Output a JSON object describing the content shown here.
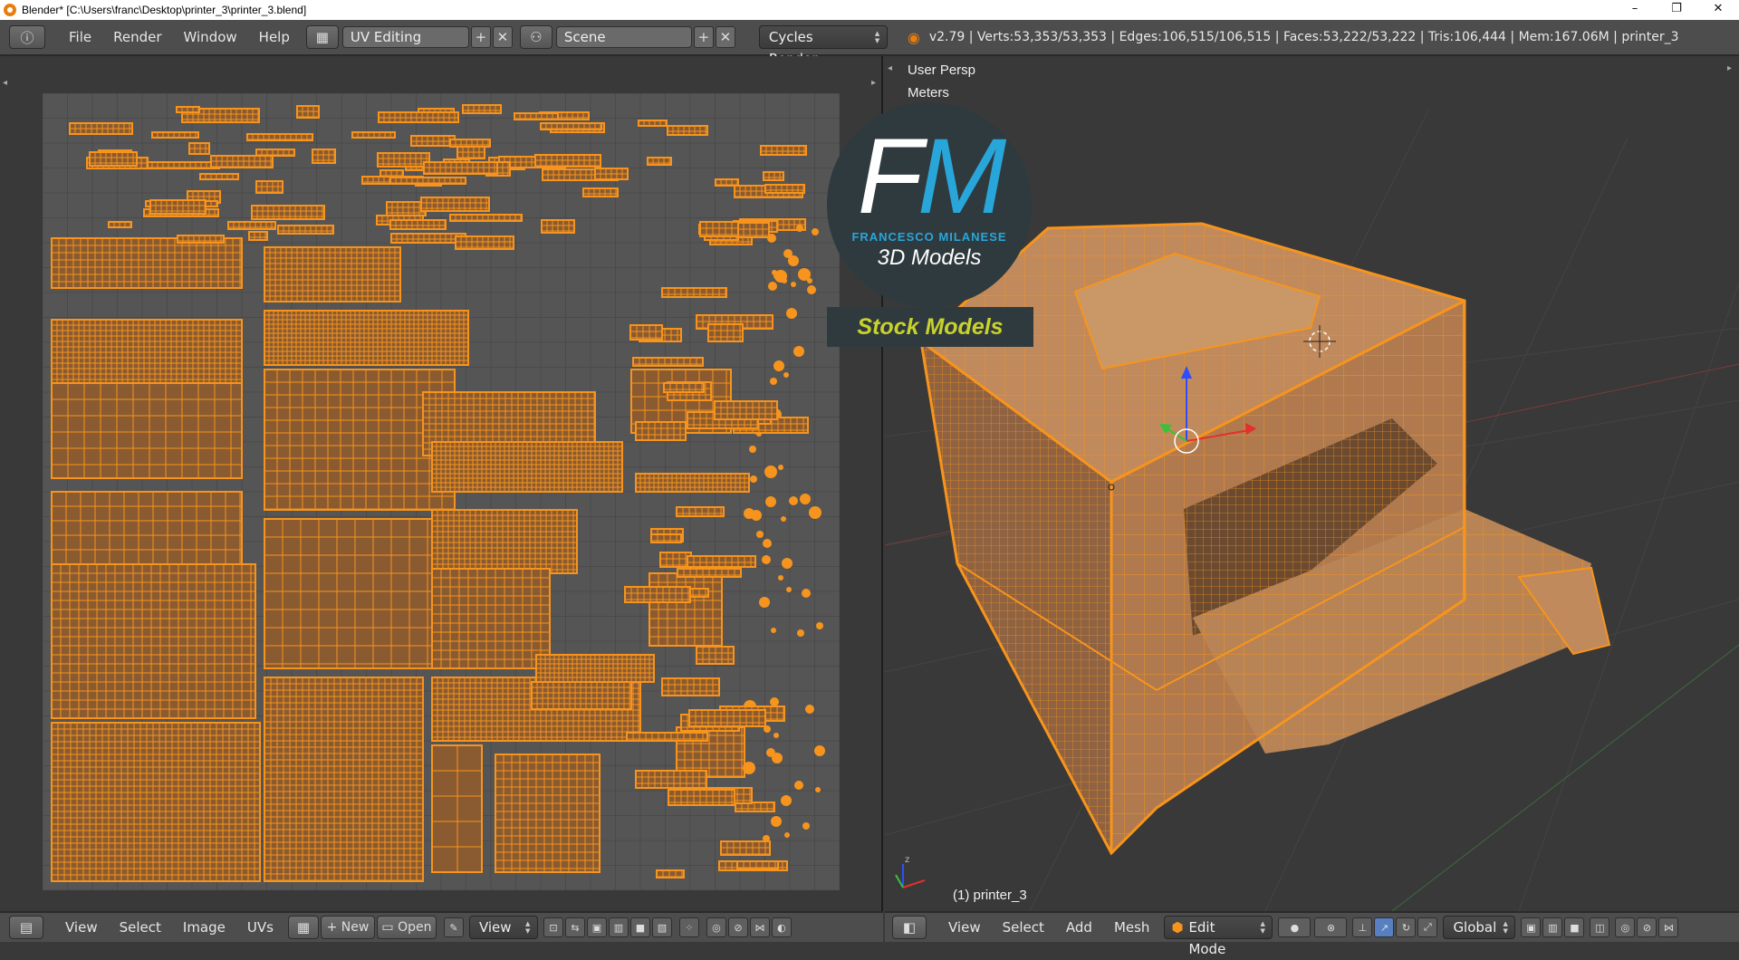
{
  "window": {
    "title": "Blender* [C:\\Users\\franc\\Desktop\\printer_3\\printer_3.blend]",
    "controls": [
      "–",
      "❐",
      "✕"
    ]
  },
  "info_header": {
    "menus": [
      "File",
      "Render",
      "Window",
      "Help"
    ],
    "layout_name": "UV Editing",
    "scene_name": "Scene",
    "render_engine": "Cycles Render",
    "stats": "v2.79 | Verts:53,353/53,353 | Edges:106,515/106,515 | Faces:53,222/53,222 | Tris:106,444 | Mem:167.06M | printer_3"
  },
  "uv_editor": {
    "menus": [
      "View",
      "Select",
      "Image",
      "UVs"
    ],
    "new_label": "New",
    "open_label": "Open",
    "view_label": "View"
  },
  "viewport": {
    "view_name": "User Persp",
    "units": "Meters",
    "object_label": "(1) printer_3",
    "menus": [
      "View",
      "Select",
      "Add",
      "Mesh"
    ],
    "mode": "Edit Mode",
    "orientation": "Global"
  },
  "watermark": {
    "letters_f": "F",
    "letters_m": "M",
    "name": "FRANCESCO MILANESE",
    "subtitle": "3D Models",
    "banner": "Stock Models"
  },
  "colors": {
    "accent": "#f7941d",
    "panel_bg": "#393939",
    "header_bg": "#4d4d4d",
    "logo_blue": "#29a6d9",
    "banner_yellow": "#c9d22a"
  }
}
